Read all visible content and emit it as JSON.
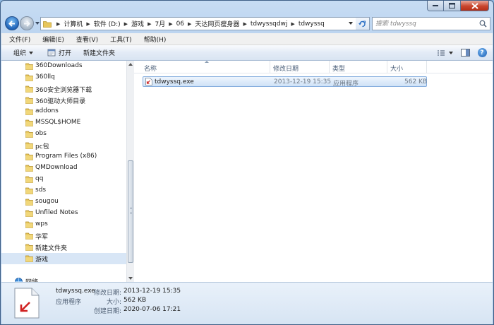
{
  "window": {
    "caption_icons": [
      "minimize-icon",
      "maximize-icon",
      "close-icon"
    ]
  },
  "address_bar": {
    "crumbs": [
      "计算机",
      "软件 (D:)",
      "游戏",
      "7月",
      "06",
      "天达网页瘦身器",
      "tdwyssqdwj",
      "tdwyssq"
    ]
  },
  "search": {
    "placeholder": "搜索 tdwyssq"
  },
  "menu": {
    "items": [
      "文件(F)",
      "编辑(E)",
      "查看(V)",
      "工具(T)",
      "帮助(H)"
    ]
  },
  "toolbar": {
    "organize_label": "组织",
    "open_label": "打开",
    "new_folder_label": "新建文件夹"
  },
  "nav_tree": {
    "items": [
      "360Downloads",
      "360llq",
      "360安全浏览器下载",
      "360驱动大师目录",
      "addons",
      "MSSQL$HOME",
      "obs",
      "pc包",
      "Program Files (x86)",
      "QMDownload",
      "qq",
      "sds",
      "sougou",
      "Unfiled Notes",
      "wps",
      "华军",
      "新建文件夹",
      "游戏"
    ],
    "selected": "游戏",
    "network_label": "网络"
  },
  "file_list": {
    "columns": [
      "名称",
      "修改日期",
      "类型",
      "大小"
    ],
    "rows": [
      {
        "name": "tdwyssq.exe",
        "modified": "2013-12-19 15:35",
        "type": "应用程序",
        "size": "562 KB"
      }
    ]
  },
  "details": {
    "name": "tdwyssq.exe",
    "type": "应用程序",
    "modified_key": "修改日期:",
    "modified": "2013-12-19 15:35",
    "size_key": "大小:",
    "size": "562 KB",
    "created_key": "创建日期:",
    "created": "2020-07-06 17:21"
  },
  "colors": {
    "accent": "#2a6fc4",
    "selection": "#cfe2f7",
    "close_button": "#c8452d"
  }
}
